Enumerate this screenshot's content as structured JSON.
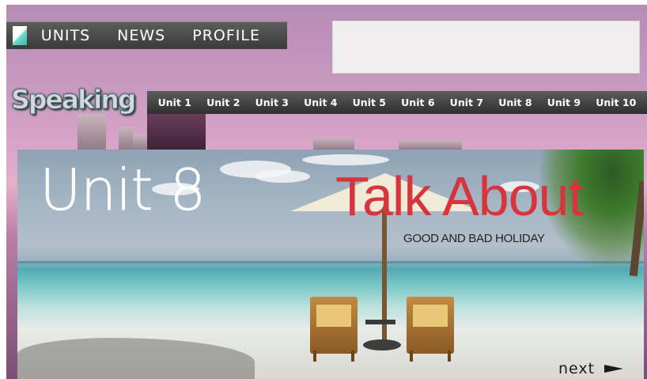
{
  "nav": {
    "items": [
      "UNITS",
      "NEWS",
      "PROFILE"
    ]
  },
  "section": {
    "title": "Speaking"
  },
  "units": [
    "Unit 1",
    "Unit 2",
    "Unit 3",
    "Unit 4",
    "Unit 5",
    "Unit 6",
    "Unit 7",
    "Unit 8",
    "Unit 9",
    "Unit 10"
  ],
  "banner": {
    "unit_label": "Unit 8",
    "title": "Talk About",
    "subtitle": "GOOD AND BAD HOLIDAY"
  },
  "pager": {
    "next_label": "next"
  },
  "colors": {
    "title_red": "#d8343c",
    "bar_dark": "#3a3a3a"
  }
}
